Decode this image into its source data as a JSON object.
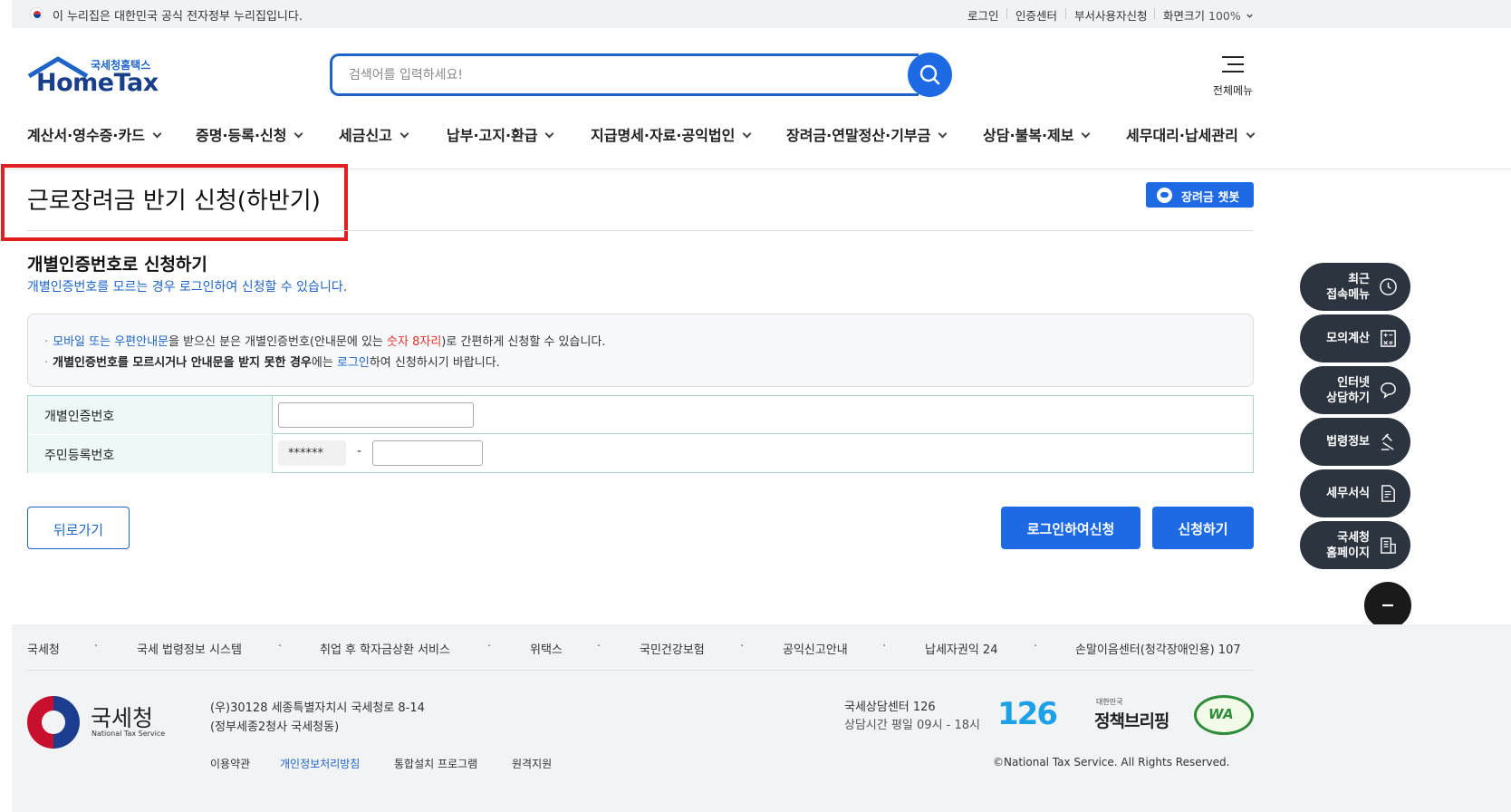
{
  "gov_banner": {
    "text": "이 누리집은 대한민국 공식 전자정부 누리집입니다.",
    "links": [
      "로그인",
      "인증센터",
      "부서사용자신청"
    ],
    "zoom_label": "화면크기",
    "zoom_value": "100%"
  },
  "header": {
    "logo_sub": "국세청홈택스",
    "logo_main": "HomeTax",
    "search_placeholder": "검색어를 입력하세요!",
    "menu_label": "전체메뉴"
  },
  "nav": [
    "계산서·영수증·카드",
    "증명·등록·신청",
    "세금신고",
    "납부·고지·환급",
    "지급명세·자료·공익법인",
    "장려금·연말정산·기부금",
    "상담·불복·제보",
    "세무대리·납세관리"
  ],
  "page": {
    "title": "근로장려금 반기 신청(하반기)",
    "chatbot_label": "장려금 챗봇",
    "section_title": "개별인증번호로 신청하기",
    "section_sub": "개별인증번호를 모르는 경우 로그인하여 신청할 수 있습니다."
  },
  "notice": {
    "line1": {
      "a": "모바일 또는 우편안내문",
      "b": "을 받으신 분은 개별인증번호(안내문에 있는 ",
      "c": "숫자 8자리",
      "d": ")로 간편하게 신청할 수 있습니다."
    },
    "line2": {
      "a": "개별인증번호를 모르시거나 안내문을 받지 못한 경우",
      "b": "에는 ",
      "c": "로그인",
      "d": "하여 신청하시기 바랍니다."
    }
  },
  "form": {
    "auth_label": "개별인증번호",
    "auth_value": "",
    "rrn_label": "주민등록번호",
    "rrn_masked": "******",
    "rrn_dash": "-",
    "rrn_value": ""
  },
  "buttons": {
    "back": "뒤로가기",
    "login_apply": "로그인하여신청",
    "apply": "신청하기"
  },
  "quick_menu": [
    {
      "label": "최근\n접속메뉴",
      "icon": "clock-icon"
    },
    {
      "label": "모의계산",
      "icon": "calculator-icon"
    },
    {
      "label": "인터넷\n상담하기",
      "icon": "chat-icon"
    },
    {
      "label": "법령정보",
      "icon": "gavel-icon"
    },
    {
      "label": "세무서식",
      "icon": "document-icon"
    },
    {
      "label": "국세청\n홈페이지",
      "icon": "building-icon"
    }
  ],
  "footer": {
    "links": [
      "국세청",
      "국세 법령정보 시스템",
      "취업 후 학자금상환 서비스",
      "위택스",
      "국민건강보험",
      "공익신고안내",
      "납세자권익 24",
      "손말이음센터(청각장애인용) 107"
    ],
    "org_name": "국세청",
    "org_en": "National Tax Service",
    "address1": "(우)30128 세종특별자치시 국세청로 8-14",
    "address2": "(정부세종2청사 국세청동)",
    "center_name": "국세상담센터 126",
    "center_hours": "상담시간 평일 09시 - 18시",
    "bottom_links": [
      "이용약관",
      "개인정보처리방침",
      "통합설치 프로그램",
      "원격지원"
    ],
    "copyright": "©National Tax Service. All Rights Reserved.",
    "logo_126": "126",
    "brief_small": "대한민국",
    "brief": "정책브리핑",
    "wa": "WA"
  },
  "colors": {
    "primary": "#1e6ae5",
    "link_blue": "#1e64c8",
    "highlight_red": "#e3322b",
    "annotation_red": "#e02020",
    "quick_bg": "#2c3440"
  }
}
